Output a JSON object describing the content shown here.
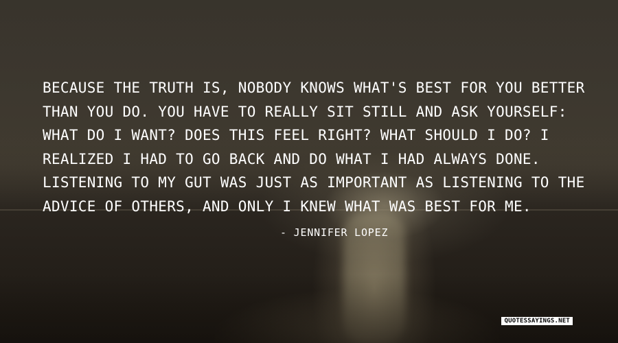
{
  "quote": {
    "text": "Because the truth is, nobody knows what's best for you better than you do. You have to really sit still and ask yourself: What do I want? Does this feel right? What should I do? I realized I had to go back and do what I had always done. Listening to my gut was just as important as listening to the advice of others, and only I knew what was best for me.",
    "author": "- Jennifer Lopez"
  },
  "watermark": {
    "text": "quotessayings.net"
  }
}
